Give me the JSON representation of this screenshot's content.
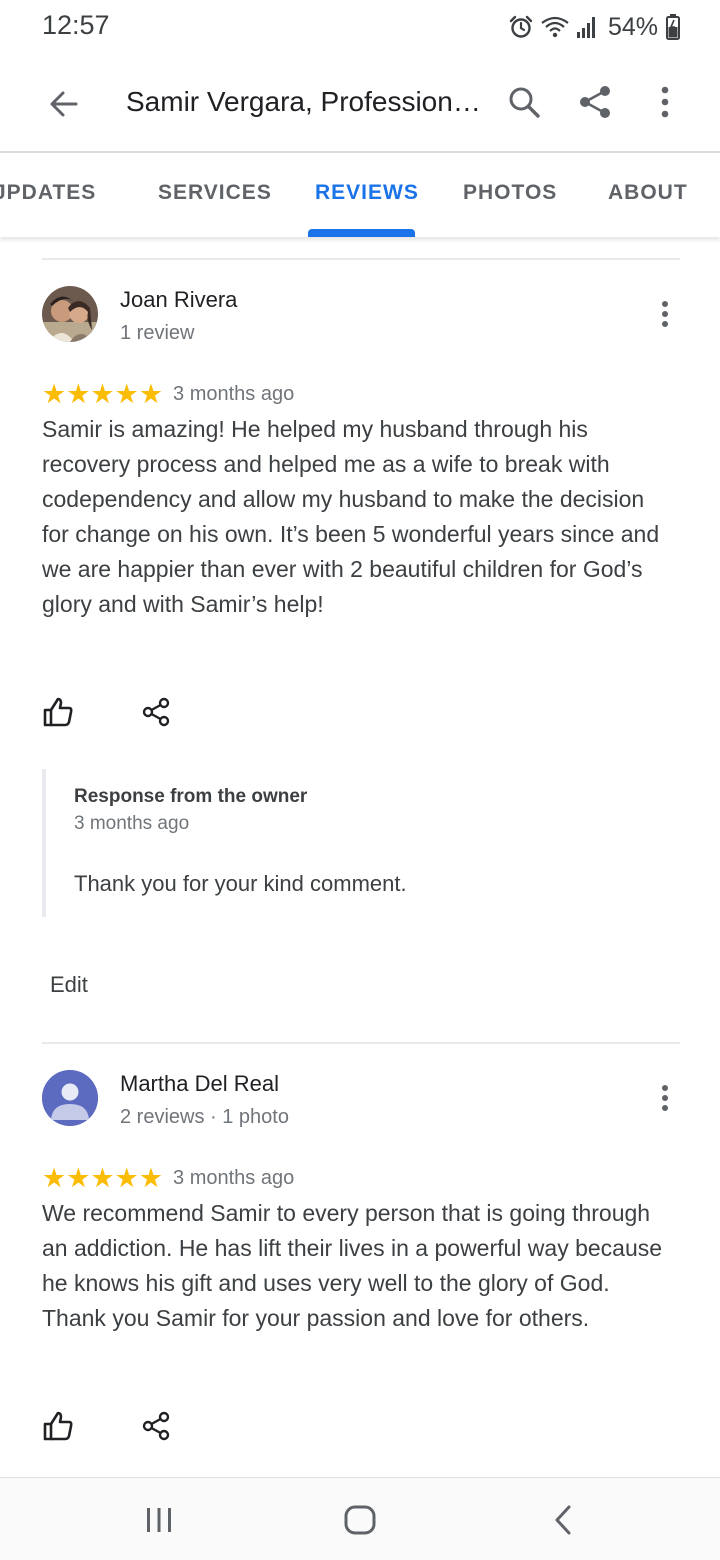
{
  "status_bar": {
    "time": "12:57",
    "battery": "54%",
    "icons": [
      "alarm-icon",
      "wifi-icon",
      "signal-icon",
      "battery-icon"
    ]
  },
  "app_bar": {
    "title": "Samir Vergara, Professional...",
    "icons": [
      "back-arrow-icon",
      "search-icon",
      "share-icon",
      "more-vert-icon"
    ]
  },
  "tabs": [
    {
      "label": "JPDATES",
      "active": false
    },
    {
      "label": "SERVICES",
      "active": false
    },
    {
      "label": "REVIEWS",
      "active": true
    },
    {
      "label": "PHOTOS",
      "active": false
    },
    {
      "label": "ABOUT",
      "active": false
    }
  ],
  "reviews": [
    {
      "name": "Joan Rivera",
      "meta": "1 review",
      "stars": "★★★★★",
      "rating": 5,
      "date": "3 months ago",
      "text": "Samir is amazing! He helped my husband through his recovery process and helped me as a wife to break with codependency and allow my husband to make the decision for change on his own. It’s been 5 wonderful years since and we are happier than ever with 2 beautiful children for God’s glory and with Samir’s help!",
      "owner_response": {
        "title": "Response from the owner",
        "date": "3 months ago",
        "text": "Thank you for your kind comment."
      },
      "edit_label": "Edit"
    },
    {
      "name": "Martha Del Real",
      "meta": "2 reviews · 1 photo",
      "stars": "★★★★★",
      "rating": 5,
      "date": "3 months ago",
      "text": "We recommend Samir to every person that is going through an addiction. He has lift their lives in a powerful way because he knows his gift and uses very well to the glory of God. Thank you Samir for your passion and love for others."
    }
  ],
  "colors": {
    "accent": "#1a73e8",
    "star": "#fbbc04",
    "avatar_default": "#5c6bc0"
  },
  "nav_bar": {
    "icons": [
      "recent-apps-icon",
      "home-icon",
      "back-icon"
    ]
  }
}
